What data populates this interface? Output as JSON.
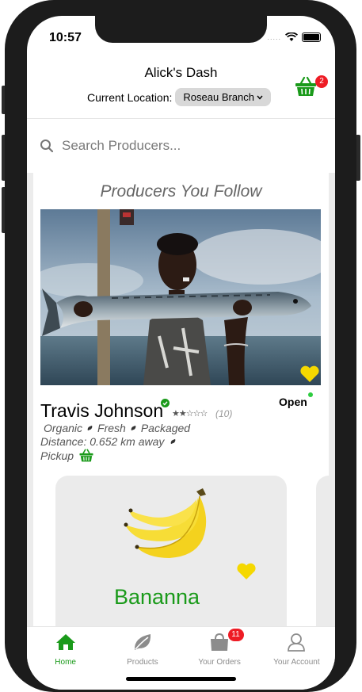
{
  "status_bar": {
    "time": "10:57",
    "signal": "....."
  },
  "header": {
    "title": "Alick's Dash",
    "location_label": "Current Location:",
    "branch": "Roseau Branch",
    "cart_count": "2"
  },
  "search": {
    "placeholder": "Search Producers..."
  },
  "feed": {
    "section_title": "Producers You Follow",
    "producer": {
      "name": "Travis Johnson",
      "rating_stars": "★★☆☆☆",
      "review_count": "(10)",
      "status": "Open",
      "tags": [
        "Organic",
        "Fresh",
        "Packaged"
      ],
      "distance": "Distance: 0.652 km away",
      "pickup": "Pickup"
    },
    "product": {
      "name": "Bananna"
    }
  },
  "tabbar": {
    "tabs": [
      {
        "label": "Home"
      },
      {
        "label": "Products"
      },
      {
        "label": "Your Orders",
        "badge": "11"
      },
      {
        "label": "Your Account"
      }
    ]
  },
  "colors": {
    "accent_green": "#1a9a1a",
    "badge_red": "#ee1c25",
    "heart_yellow": "#f5d800",
    "open_dot": "#2ecc40"
  },
  "icons": [
    "search-icon",
    "basket-icon",
    "verified-icon",
    "heart-icon",
    "leaf-icon",
    "home-icon",
    "products-leaf-icon",
    "orders-bag-icon",
    "account-person-icon"
  ]
}
